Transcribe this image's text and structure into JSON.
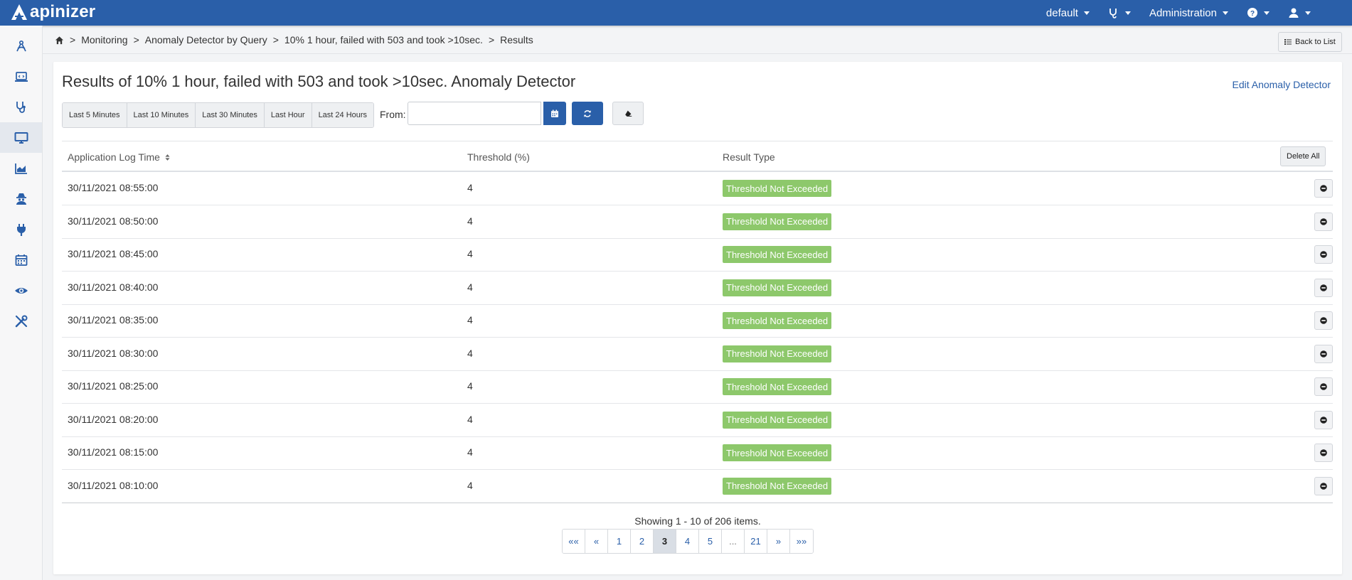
{
  "app": {
    "logo_text": "apinizer"
  },
  "topbar": {
    "items": [
      {
        "label": "default"
      },
      {
        "label": ""
      },
      {
        "label": "Administration"
      },
      {
        "label": ""
      },
      {
        "label": ""
      }
    ]
  },
  "sidebar": {
    "items": [
      {
        "icon": "design-icon"
      },
      {
        "icon": "laptop-code-icon"
      },
      {
        "icon": "stethoscope-icon"
      },
      {
        "icon": "monitor-icon",
        "active": true
      },
      {
        "icon": "chart-area-icon"
      },
      {
        "icon": "user-secret-icon"
      },
      {
        "icon": "plug-icon"
      },
      {
        "icon": "calendar-icon"
      },
      {
        "icon": "eye-icon"
      },
      {
        "icon": "tools-icon"
      }
    ]
  },
  "breadcrumb": {
    "items": [
      "Monitoring",
      "Anomaly Detector by Query",
      "10% 1 hour, failed with 503 and took >10sec.",
      "Results"
    ]
  },
  "back_button": "Back to List",
  "page": {
    "title": "Results of 10% 1 hour, failed with 503 and took >10sec. Anomaly Detector",
    "edit_link": "Edit Anomaly Detector"
  },
  "filters": {
    "ranges": [
      "Last 5 Minutes",
      "Last 10 Minutes",
      "Last 30 Minutes",
      "Last Hour",
      "Last 24 Hours"
    ],
    "from_label": "From:",
    "from_value": "",
    "from_placeholder": ""
  },
  "table": {
    "headers": {
      "time": "Application Log Time",
      "threshold": "Threshold (%)",
      "result": "Result Type"
    },
    "delete_all": "Delete All",
    "rows": [
      {
        "time": "30/11/2021 08:55:00",
        "threshold": "4",
        "result": "Threshold Not Exceeded"
      },
      {
        "time": "30/11/2021 08:50:00",
        "threshold": "4",
        "result": "Threshold Not Exceeded"
      },
      {
        "time": "30/11/2021 08:45:00",
        "threshold": "4",
        "result": "Threshold Not Exceeded"
      },
      {
        "time": "30/11/2021 08:40:00",
        "threshold": "4",
        "result": "Threshold Not Exceeded"
      },
      {
        "time": "30/11/2021 08:35:00",
        "threshold": "4",
        "result": "Threshold Not Exceeded"
      },
      {
        "time": "30/11/2021 08:30:00",
        "threshold": "4",
        "result": "Threshold Not Exceeded"
      },
      {
        "time": "30/11/2021 08:25:00",
        "threshold": "4",
        "result": "Threshold Not Exceeded"
      },
      {
        "time": "30/11/2021 08:20:00",
        "threshold": "4",
        "result": "Threshold Not Exceeded"
      },
      {
        "time": "30/11/2021 08:15:00",
        "threshold": "4",
        "result": "Threshold Not Exceeded"
      },
      {
        "time": "30/11/2021 08:10:00",
        "threshold": "4",
        "result": "Threshold Not Exceeded"
      }
    ]
  },
  "pagination": {
    "summary": "Showing 1 - 10 of 206 items.",
    "pages": [
      "««",
      "«",
      "1",
      "2",
      "3",
      "4",
      "5",
      "...",
      "21",
      "»",
      "»»"
    ],
    "current": "3"
  },
  "colors": {
    "brand": "#2a5fa9",
    "badge_success": "#8dc86b"
  }
}
